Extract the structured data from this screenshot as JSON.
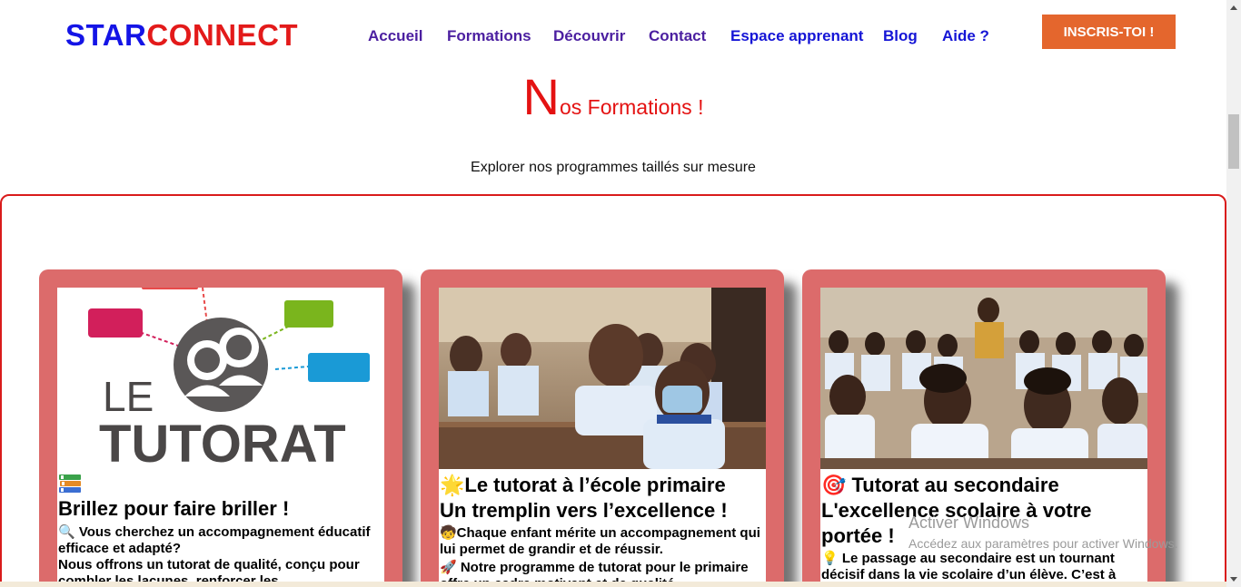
{
  "header": {
    "logo_part1": "STAR",
    "logo_part2": "CONNECT",
    "nav": [
      {
        "label": "Accueil",
        "color": "#4b1fa0"
      },
      {
        "label": "Formations",
        "color": "#4b1fa0"
      },
      {
        "label": "Découvrir",
        "color": "#4b1fa0"
      },
      {
        "label": "Contact",
        "color": "#4b1fa0"
      },
      {
        "label": "Espace apprenant",
        "color": "#1515d6"
      },
      {
        "label": "Blog",
        "color": "#1515d6"
      },
      {
        "label": "Aide ?",
        "color": "#1515d6"
      }
    ],
    "cta_label": "INSCRIS-TOI !"
  },
  "section": {
    "heading_first_letter": "N",
    "heading_rest": "os Formations !",
    "subtitle": "Explorer nos programmes taillés sur mesure"
  },
  "cards": [
    {
      "image_alt": "Le tutorat logo",
      "image_text_line1": "LE",
      "image_text_line2": "TUTORAT",
      "icon": "books-icon",
      "title_lines": [
        "Brillez pour faire briller !"
      ],
      "paragraphs": [
        {
          "icon": "magnifier-icon",
          "text": "🔍 Vous cherchez un accompagnement éducatif efficace et adapté?"
        },
        {
          "icon": "",
          "text": "Nous offrons un tutorat de qualité, conçu pour combler les lacunes, renforcer les"
        }
      ]
    },
    {
      "image_alt": "Élèves d'école primaire en classe",
      "icon": "star-icon",
      "title_lines": [
        "🌟Le tutorat à l’école primaire",
        "Un tremplin vers l’excellence !"
      ],
      "paragraphs": [
        {
          "icon": "child-icon",
          "text": "🧒Chaque enfant mérite un accompagnement qui lui permet de grandir et de réussir."
        },
        {
          "icon": "rocket-icon",
          "text": "🚀 Notre programme de tutorat pour le primaire offre un cadre motivant et de qualité"
        }
      ]
    },
    {
      "image_alt": "Élèves du secondaire en classe",
      "icon": "target-icon",
      "title_lines": [
        "🎯 Tutorat au secondaire",
        "L'excellence scolaire à votre portée !"
      ],
      "paragraphs": [
        {
          "icon": "bulb-icon",
          "text": "💡 Le passage au secondaire est un tournant décisif dans la vie scolaire d’un élève. C’est à"
        }
      ]
    }
  ],
  "watermark": {
    "line1": "Activer Windows",
    "line2": "Accédez aux paramètres pour activer Windows."
  },
  "colors": {
    "logo_blue": "#1414e6",
    "logo_red": "#e31a1a",
    "cta_orange": "#e4662d",
    "card_border": "#dc6b6b",
    "frame_red": "#d91b1b"
  }
}
